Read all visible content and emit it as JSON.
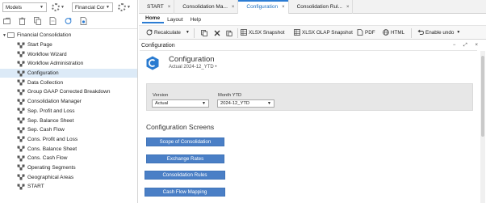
{
  "left": {
    "models_select": "Models",
    "cube_select": "Financial Cor",
    "tree": {
      "root": "Financial Consolidation",
      "items": [
        "Start Page",
        "Workflow Wizard",
        "Workflow Administration",
        "Configuration",
        "Data Collection",
        "Group GAAP Corrected Breakdown",
        "Consolidation Manager",
        "Sep. Profit and Loss",
        "Sep. Balance Sheet",
        "Sep. Cash Flow",
        "Cons. Profit and Loss",
        "Cons. Balance Sheet",
        "Cons. Cash Flow",
        "Operating Segments",
        "Geographical Areas",
        "START"
      ],
      "selected_index": 3
    }
  },
  "tabs": [
    {
      "label": "START",
      "close": "×"
    },
    {
      "label": "Consolidation Ma...",
      "close": "×"
    },
    {
      "label": "Configuration",
      "close": "×"
    },
    {
      "label": "Consolidation Rul...",
      "close": "×"
    }
  ],
  "menu": [
    "Home",
    "Layout",
    "Help"
  ],
  "toolbar": {
    "recalculate": "Recalculate",
    "xlsx_snapshot": "XLSX Snapshot",
    "xlsx_olap_snapshot": "XLSX OLAP Snapshot",
    "pdf": "PDF",
    "html": "HTML",
    "enable_undo": "Enable undo"
  },
  "panel": {
    "title": "Configuration",
    "controls": "− ⤢ ×"
  },
  "content": {
    "title": "Configuration",
    "subtitle": "Actual 2024-12_YTD •",
    "version_label": "Version",
    "version_value": "Actual",
    "month_label": "Month YTD",
    "month_value": "2024-12_YTD",
    "section_title": "Configuration Screens",
    "buttons": [
      "Scope of Consolidation",
      "Exchange Rates",
      "Consolidation Rules",
      "Cash Flow Mapping"
    ]
  },
  "colors": {
    "accent": "#2b7cd3",
    "button_blue": "#4a7fc6",
    "selected_row": "#dceaf7"
  }
}
